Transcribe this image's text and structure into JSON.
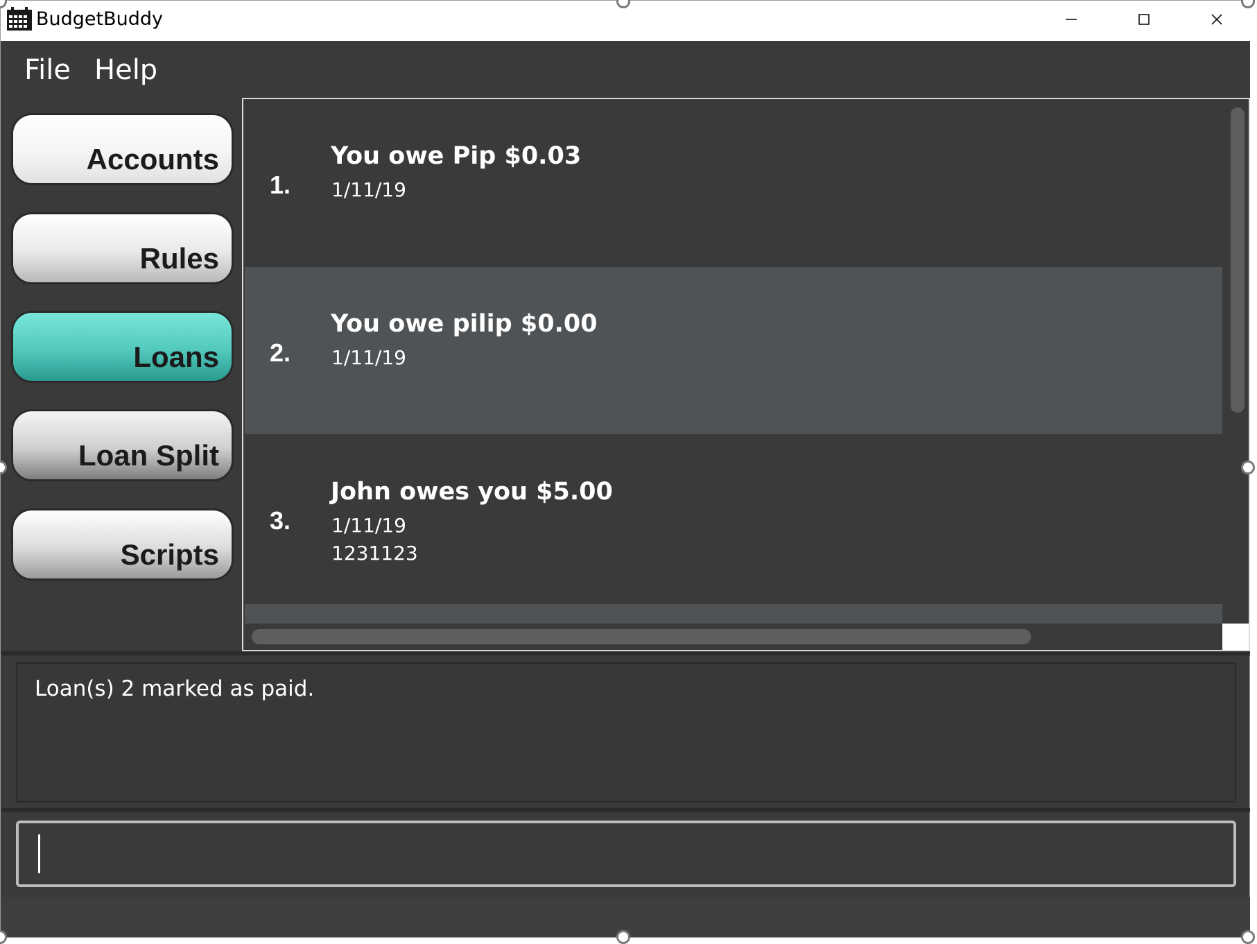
{
  "window": {
    "title": "BudgetBuddy",
    "controls": {
      "minimize": "minimize-icon",
      "maximize": "maximize-icon",
      "close": "close-icon"
    }
  },
  "menu": {
    "file": "File",
    "help": "Help"
  },
  "sidebar": {
    "items": [
      {
        "label": "Accounts"
      },
      {
        "label": "Rules"
      },
      {
        "label": "Loans"
      },
      {
        "label": "Loan Split"
      },
      {
        "label": "Scripts"
      }
    ],
    "active": "Loans"
  },
  "loans": [
    {
      "index": "1.",
      "title": "You owe Pip $0.03",
      "date": "1/11/19",
      "description": ""
    },
    {
      "index": "2.",
      "title": "You owe pilip $0.00",
      "date": "1/11/19",
      "description": ""
    },
    {
      "index": "3.",
      "title": "John owes you $5.00",
      "date": "1/11/19",
      "description": "1231123"
    }
  ],
  "result": {
    "message": "Loan(s) 2 marked as paid."
  },
  "command": {
    "value": ""
  },
  "colors": {
    "background": "#3a3a3b",
    "row_alt": "#4f5356",
    "active_tab": "#52c9bc",
    "text": "#ffffff"
  }
}
